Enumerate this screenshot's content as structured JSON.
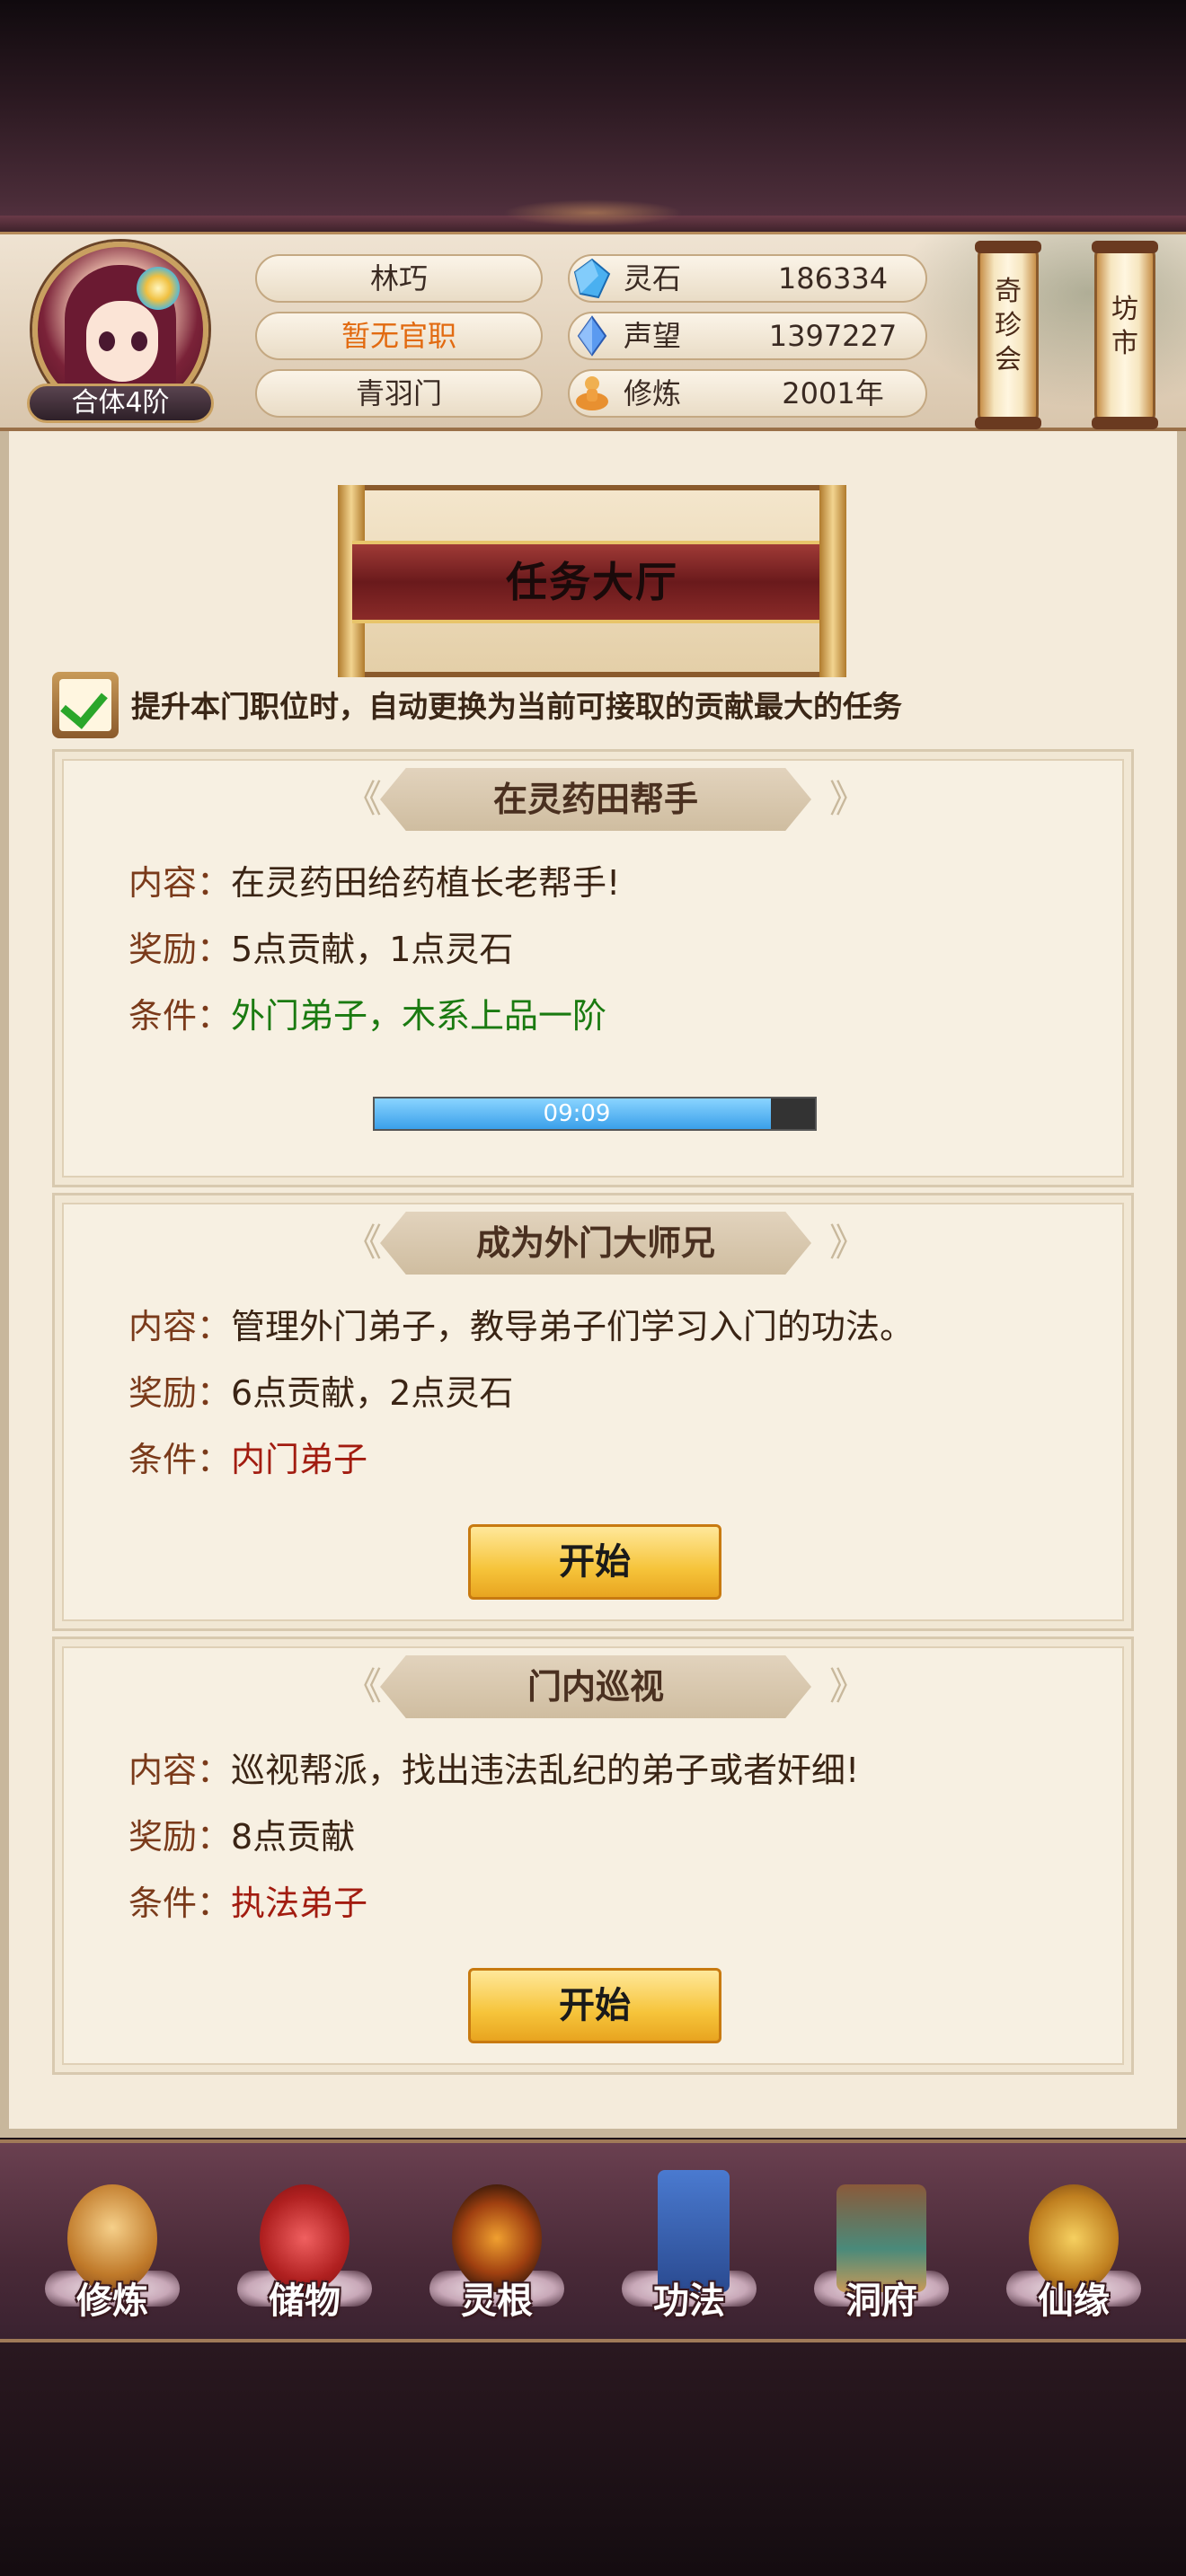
{
  "header": {
    "rank": "合体4阶",
    "name": "林巧",
    "office": "暂无官职",
    "sect": "青羽门",
    "stats": [
      {
        "label": "灵石",
        "value": "186334",
        "icon": "spirit-stone-icon",
        "color": "#3a9ae8"
      },
      {
        "label": "声望",
        "value": "1397227",
        "icon": "prestige-crystal-icon",
        "color": "#3a7ae8"
      },
      {
        "label": "修炼",
        "value": "2001年",
        "icon": "meditation-figure-icon",
        "color": "#e8a040"
      }
    ],
    "side_buttons": [
      {
        "label_chars": [
          "奇",
          "珍",
          "会"
        ]
      },
      {
        "label_chars": [
          "坊",
          "市"
        ]
      }
    ]
  },
  "title": "任务大厅",
  "auto_switch": {
    "checked": true,
    "label": "提升本门职位时，自动更换为当前可接取的贡献最大的任务"
  },
  "tasks": [
    {
      "title": "在灵药田帮手",
      "content_key": "内容：",
      "content": "在灵药田给药植长老帮手!",
      "reward_key": "奖励：",
      "reward": "5点贡献，1点灵石",
      "condition_key": "条件：",
      "condition": "外门弟子，木系上品一阶",
      "condition_color": "#1a7a10",
      "progress": {
        "text": "09:09",
        "fraction": 0.9
      }
    },
    {
      "title": "成为外门大师兄",
      "content_key": "内容：",
      "content": "管理外门弟子，教导弟子们学习入门的功法。",
      "reward_key": "奖励：",
      "reward": "6点贡献，2点灵石",
      "condition_key": "条件：",
      "condition": "内门弟子",
      "condition_color": "#a21c10",
      "button": "开始"
    },
    {
      "title": "门内巡视",
      "content_key": "内容：",
      "content": "巡视帮派，找出违法乱纪的弟子或者奸细!",
      "reward_key": "奖励：",
      "reward": "8点贡献",
      "condition_key": "条件：",
      "condition": "执法弟子",
      "condition_color": "#a21c10",
      "button": "开始"
    }
  ],
  "nav": [
    {
      "label": "修炼",
      "icon": "cultivation-monk-icon"
    },
    {
      "label": "储物",
      "icon": "storage-bag-icon"
    },
    {
      "label": "灵根",
      "icon": "spirit-root-icon"
    },
    {
      "label": "功法",
      "icon": "technique-book-icon"
    },
    {
      "label": "洞府",
      "icon": "cave-residence-icon"
    },
    {
      "label": "仙缘",
      "icon": "immortal-gourd-icon"
    }
  ]
}
